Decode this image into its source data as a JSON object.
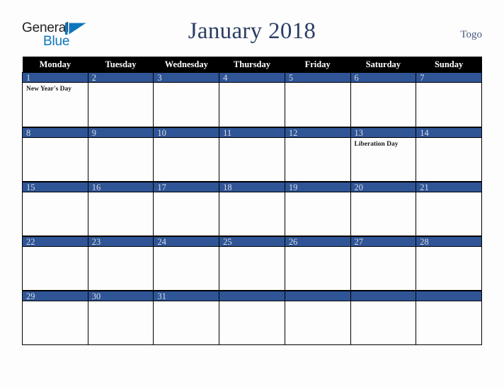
{
  "brand": {
    "name_part1": "General",
    "name_part2": "Blue",
    "mark_icon": "triangle-mark-icon"
  },
  "header": {
    "title": "January 2018",
    "region": "Togo"
  },
  "colors": {
    "header_row_bg": "#000000",
    "day_bar_bg": "#2f5596",
    "title_text": "#2c3e63",
    "brand_blue": "#0e76bc",
    "page_bg": "#fdfdfd"
  },
  "calendar": {
    "weekday_headers": [
      "Monday",
      "Tuesday",
      "Wednesday",
      "Thursday",
      "Friday",
      "Saturday",
      "Sunday"
    ],
    "weeks": [
      [
        {
          "day": "1",
          "events": [
            "New Year's Day"
          ]
        },
        {
          "day": "2",
          "events": []
        },
        {
          "day": "3",
          "events": []
        },
        {
          "day": "4",
          "events": []
        },
        {
          "day": "5",
          "events": []
        },
        {
          "day": "6",
          "events": []
        },
        {
          "day": "7",
          "events": []
        }
      ],
      [
        {
          "day": "8",
          "events": []
        },
        {
          "day": "9",
          "events": []
        },
        {
          "day": "10",
          "events": []
        },
        {
          "day": "11",
          "events": []
        },
        {
          "day": "12",
          "events": []
        },
        {
          "day": "13",
          "events": [
            "Liberation Day"
          ]
        },
        {
          "day": "14",
          "events": []
        }
      ],
      [
        {
          "day": "15",
          "events": []
        },
        {
          "day": "16",
          "events": []
        },
        {
          "day": "17",
          "events": []
        },
        {
          "day": "18",
          "events": []
        },
        {
          "day": "19",
          "events": []
        },
        {
          "day": "20",
          "events": []
        },
        {
          "day": "21",
          "events": []
        }
      ],
      [
        {
          "day": "22",
          "events": []
        },
        {
          "day": "23",
          "events": []
        },
        {
          "day": "24",
          "events": []
        },
        {
          "day": "25",
          "events": []
        },
        {
          "day": "26",
          "events": []
        },
        {
          "day": "27",
          "events": []
        },
        {
          "day": "28",
          "events": []
        }
      ],
      [
        {
          "day": "29",
          "events": []
        },
        {
          "day": "30",
          "events": []
        },
        {
          "day": "31",
          "events": []
        },
        {
          "day": "",
          "events": []
        },
        {
          "day": "",
          "events": []
        },
        {
          "day": "",
          "events": []
        },
        {
          "day": "",
          "events": []
        }
      ]
    ]
  }
}
